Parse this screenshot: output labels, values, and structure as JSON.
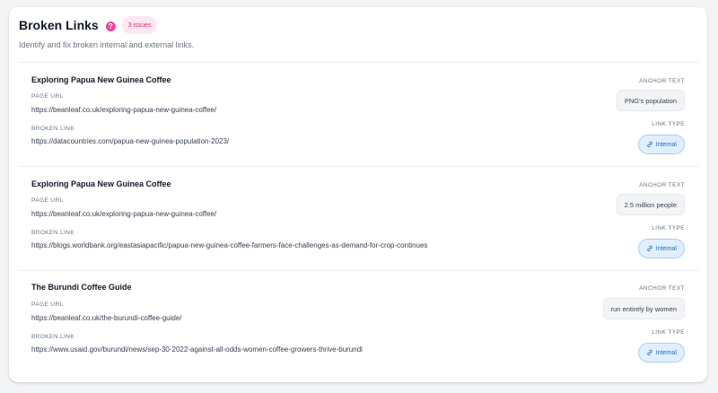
{
  "header": {
    "title": "Broken Links",
    "help_glyph": "?",
    "badge": "3 issues",
    "subtitle": "Identify and fix broken internal and external links."
  },
  "labels": {
    "page_url": "PAGE URL",
    "broken_link": "BROKEN LINK",
    "anchor_text": "ANCHOR TEXT",
    "link_type": "LINK TYPE"
  },
  "issues": [
    {
      "title": "Exploring Papua New Guinea Coffee",
      "page_url": "https://beanleaf.co.uk/exploring-papua-new-guinea-coffee/",
      "broken_link": "https://datacountries.com/papua-new-guinea-population-2023/",
      "anchor_text": "PNG's population",
      "link_type": "Internal"
    },
    {
      "title": "Exploring Papua New Guinea Coffee",
      "page_url": "https://beanleaf.co.uk/exploring-papua-new-guinea-coffee/",
      "broken_link": "https://blogs.worldbank.org/eastasiapacific/papua-new-guinea-coffee-farmers-face-challenges-as-demand-for-crop-continues",
      "anchor_text": "2.5 million people",
      "link_type": "Internal"
    },
    {
      "title": "The Burundi Coffee Guide",
      "page_url": "https://beanleaf.co.uk/the-burundi-coffee-guide/",
      "broken_link": "https://www.usaid.gov/burundi/news/sep-30-2022-against-all-odds-women-coffee-growers-thrive-burundi",
      "anchor_text": "run entirely by women",
      "link_type": "Internal"
    }
  ],
  "colors": {
    "accent_pink": "#ec4899",
    "badge_bg": "#fde7f1",
    "link_type_bg": "#e0effe",
    "link_type_text": "#1d6fb8"
  },
  "icons": {
    "help": "help-icon",
    "link_type": "link-icon"
  }
}
